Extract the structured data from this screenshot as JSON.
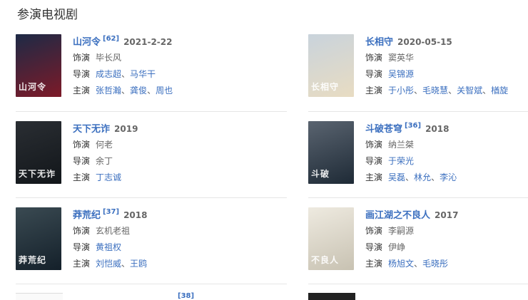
{
  "section": {
    "title": "参演电视剧"
  },
  "labels": {
    "role": "饰演",
    "director": "导演",
    "stars": "主演"
  },
  "items": [
    {
      "title": "山河令",
      "sup": "[62]",
      "year": "2021-2-22",
      "role": "毕长风",
      "directors": [
        "成志超",
        "马华干"
      ],
      "stars": [
        "张哲瀚",
        "龚俊",
        "周也"
      ],
      "poster_caption": "山河令",
      "poster_colors": [
        "#1d2a46",
        "#7d1a28"
      ]
    },
    {
      "title": "长相守",
      "sup": "",
      "year": "2020-05-15",
      "role": "窦英华",
      "directors": [
        "吴锦源"
      ],
      "stars": [
        "于小彤",
        "毛晓慧",
        "关智斌",
        "楢旋"
      ],
      "poster_caption": "长相守",
      "poster_colors": [
        "#c9d3dc",
        "#e8dcc2"
      ]
    },
    {
      "title": "天下无诈",
      "sup": "",
      "year": "2019",
      "role": "何老",
      "directors": [
        "余丁"
      ],
      "stars": [
        "丁志诚"
      ],
      "poster_caption": "天下无诈",
      "poster_colors": [
        "#2a2e33",
        "#12161a"
      ]
    },
    {
      "title": "斗破苍穹",
      "sup": "[36]",
      "year": "2018",
      "role": "纳兰桀",
      "directors": [
        "于荣光"
      ],
      "stars": [
        "吴磊",
        "林允",
        "李沁"
      ],
      "poster_caption": "斗破",
      "poster_colors": [
        "#5a6470",
        "#1e2a36"
      ]
    },
    {
      "title": "莽荒纪",
      "sup": "[37]",
      "year": "2018",
      "role": "玄机老祖",
      "directors": [
        "黄祖权"
      ],
      "stars": [
        "刘恺威",
        "王鸥"
      ],
      "poster_caption": "莽荒纪",
      "poster_colors": [
        "#3a4a52",
        "#14202a"
      ]
    },
    {
      "title": "画江湖之不良人",
      "sup": "",
      "year": "2017",
      "role": "李嗣源",
      "directors": [
        "伊峥"
      ],
      "stars": [
        "杨旭文",
        "毛晓彤"
      ],
      "poster_caption": "不良人",
      "poster_colors": [
        "#eeeae0",
        "#c8c2b2"
      ]
    }
  ],
  "partial_sup": "[38]"
}
